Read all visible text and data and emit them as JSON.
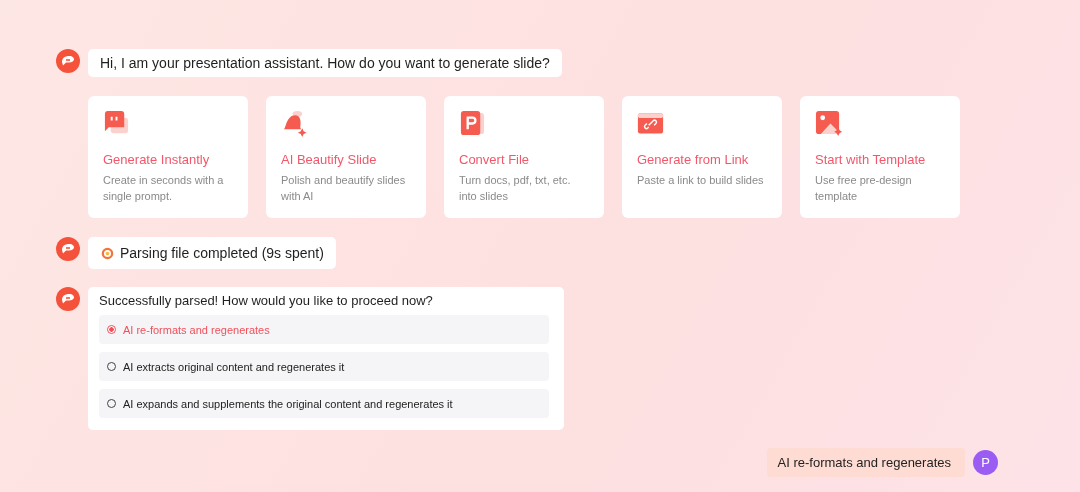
{
  "greeting": "Hi, I am your presentation assistant. How do you want to generate slide?",
  "cards": [
    {
      "kind": "chat",
      "title": "Generate Instantly",
      "description": "Create in seconds with a single prompt."
    },
    {
      "kind": "bell",
      "title": "AI Beautify Slide",
      "description": "Polish and beautify slides with AI"
    },
    {
      "kind": "file",
      "title": "Convert File",
      "description": "Turn docs, pdf, txt, etc. into slides"
    },
    {
      "kind": "link",
      "title": "Generate from Link",
      "description": "Paste a link to build slides"
    },
    {
      "kind": "image",
      "title": "Start with Template",
      "description": "Use free pre-design template"
    }
  ],
  "status": "Parsing file completed (9s spent)",
  "question": "Successfully parsed! How would you like to proceed now?",
  "options": [
    {
      "label": "AI re-formats and regenerates",
      "selected": true
    },
    {
      "label": "AI extracts original content and regenerates it",
      "selected": false
    },
    {
      "label": "AI expands and supplements the original content and regenerates it",
      "selected": false
    }
  ],
  "reply": {
    "text": "AI re-formats and regenerates",
    "avatar": "P"
  }
}
